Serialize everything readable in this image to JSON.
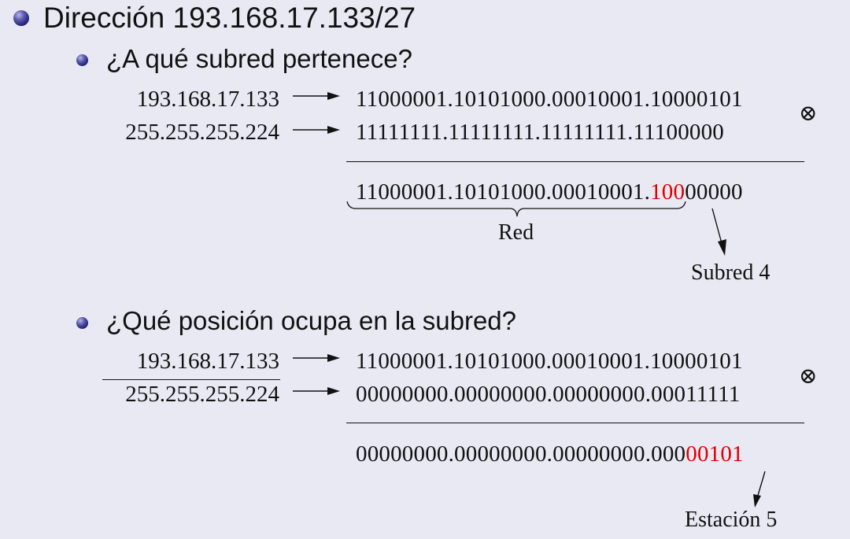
{
  "heading": "Dirección 193.168.17.133/27",
  "section1": {
    "question": "¿A qué subred pertenece?",
    "ip": "193.168.17.133",
    "mask": "255.255.255.224",
    "ip_bin": "11000001.10101000.00010001.10000101",
    "mask_bin": "11111111.11111111.11111111.11100000",
    "op_symbol": "⊗",
    "result_prefix": "11000001.10101000.00010001.",
    "result_highlight": "100",
    "result_suffix": "00000",
    "brace_label": "Red",
    "pointer_label": "Subred 4"
  },
  "section2": {
    "question": "¿Qué posición ocupa en la subred?",
    "ip": "193.168.17.133",
    "mask": "255.255.255.224",
    "ip_bin": "11000001.10101000.00010001.10000101",
    "mask_bin": "00000000.00000000.00000000.00011111",
    "op_symbol": "⊗",
    "result_prefix": "00000000.00000000.00000000.000",
    "result_highlight": "00101",
    "result_suffix": "",
    "pointer_label": "Estación 5"
  },
  "colors": {
    "background": "#e9e9f4",
    "highlight": "#e00000",
    "bullet": "#2b2b7a"
  }
}
